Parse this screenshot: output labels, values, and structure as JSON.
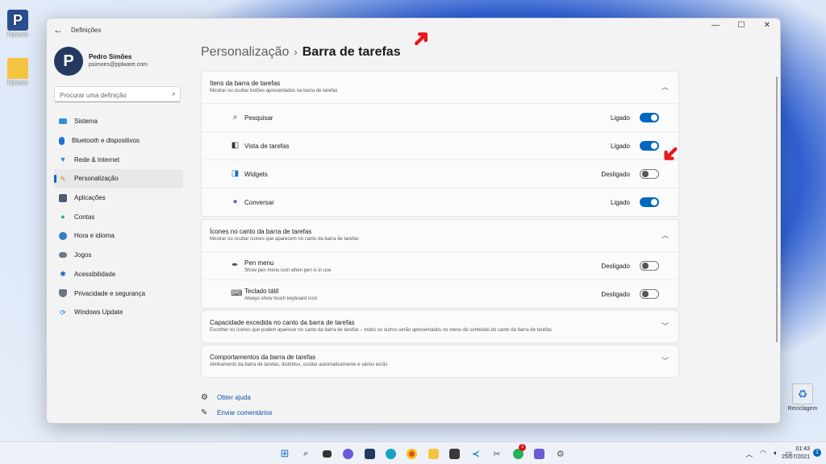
{
  "desktop": {
    "icons": [
      {
        "label": "Pplware"
      },
      {
        "label": "Pplware"
      },
      {
        "label": "Reciclagem"
      }
    ]
  },
  "window": {
    "app_title": "Definições",
    "controls": {
      "minimize": "—",
      "maximize": "☐",
      "close": "✕"
    }
  },
  "profile": {
    "name": "Pedro Simões",
    "email": "psimoes@pplware.com",
    "avatar_letter": "P"
  },
  "search": {
    "placeholder": "Procurar uma definição"
  },
  "sidebar": {
    "items": [
      {
        "label": "Sistema",
        "icon": "system-icon",
        "color": "#2f8fd8"
      },
      {
        "label": "Bluetooth e dispositivos",
        "icon": "bluetooth-icon",
        "color": "#1f6fd0"
      },
      {
        "label": "Rede & Internet",
        "icon": "wifi-icon",
        "color": "#2b8ae0"
      },
      {
        "label": "Personalização",
        "icon": "brush-icon",
        "color": "#d08a2a",
        "active": true
      },
      {
        "label": "Aplicações",
        "icon": "apps-icon",
        "color": "#4b5c73"
      },
      {
        "label": "Contas",
        "icon": "accounts-icon",
        "color": "#2aa889"
      },
      {
        "label": "Hora e idioma",
        "icon": "globe-clock-icon",
        "color": "#2f7fc8"
      },
      {
        "label": "Jogos",
        "icon": "gamepad-icon",
        "color": "#6f7a88"
      },
      {
        "label": "Acessibilidade",
        "icon": "accessibility-icon",
        "color": "#1f5fb8"
      },
      {
        "label": "Privacidade e segurança",
        "icon": "shield-icon",
        "color": "#6b7480"
      },
      {
        "label": "Windows Update",
        "icon": "update-icon",
        "color": "#1e7ad8"
      }
    ]
  },
  "breadcrumb": {
    "parent": "Personalização",
    "separator": "›",
    "current": "Barra de tarefas"
  },
  "groups": {
    "taskbar_items": {
      "title": "Itens da barra de tarefas",
      "subtitle": "Mostrar ou ocultar botões apresentados na barra de tarefas",
      "rows": [
        {
          "label": "Pesquisar",
          "icon": "search-icon",
          "state": "Ligado",
          "on": true
        },
        {
          "label": "Vista de tarefas",
          "icon": "task-view-icon",
          "state": "Ligado",
          "on": true
        },
        {
          "label": "Widgets",
          "icon": "widgets-icon",
          "state": "Desligado",
          "on": false
        },
        {
          "label": "Conversar",
          "icon": "chat-icon",
          "state": "Ligado",
          "on": true
        }
      ]
    },
    "corner_icons": {
      "title": "Ícones no canto da barra de tarefas",
      "subtitle": "Mostrar ou ocultar ícones que aparecem no canto da barra de tarefas",
      "rows": [
        {
          "label": "Pen menu",
          "sub": "Show pen menu icon when pen is in use",
          "icon": "pen-icon",
          "state": "Desligado",
          "on": false
        },
        {
          "label": "Teclado tátil",
          "sub": "Always show touch keyboard icon",
          "icon": "keyboard-icon",
          "state": "Desligado",
          "on": false
        }
      ]
    },
    "corner_overflow": {
      "title": "Capacidade excedida no canto da barra de tarefas",
      "subtitle": "Escolher os ícones que podem aparecer no canto da barra de tarefas – todos os outros serão apresentados no menu de conteúdo do canto da barra de tarefas"
    },
    "behaviors": {
      "title": "Comportamentos da barra de tarefas",
      "subtitle": "Alinhamento da barra de tarefas, distintivo, ocultar automaticamente e vários ecrãs"
    }
  },
  "footer": {
    "help": "Obter ajuda",
    "feedback": "Enviar comentários"
  },
  "taskbar": {
    "badge_count": "1",
    "time": "01:43",
    "date": "25/07/2021",
    "notifications": "1"
  },
  "colors": {
    "accent": "#0067c0",
    "annotation_arrow": "#e81818"
  }
}
